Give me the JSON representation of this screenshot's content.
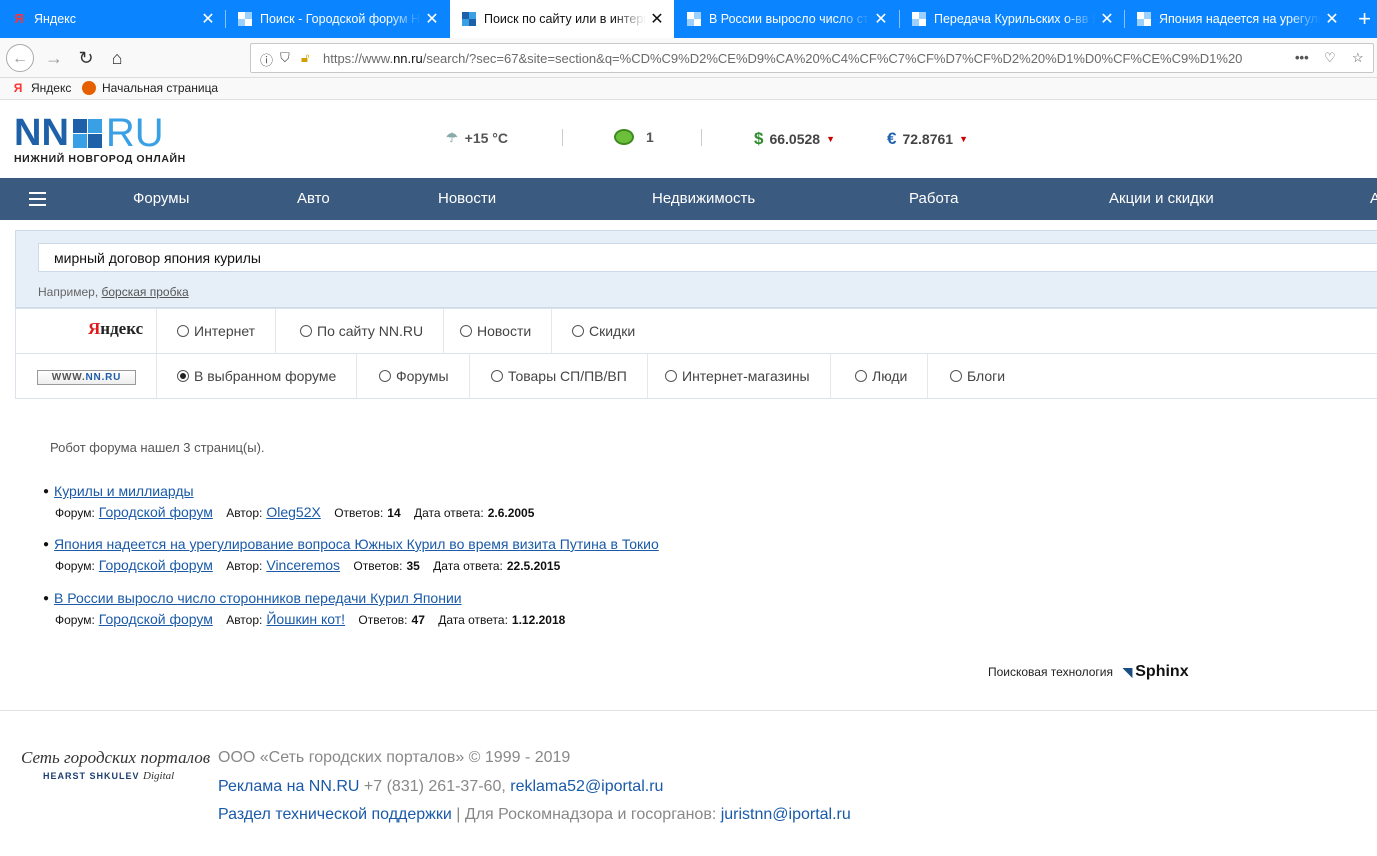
{
  "browser": {
    "tabs": [
      {
        "title": "Яндекс",
        "active": false
      },
      {
        "title": "Поиск - Городской форум Нижнего Новгорода",
        "active": false
      },
      {
        "title": "Поиск по сайту или в интернете",
        "active": true
      },
      {
        "title": "В России выросло число сторонников",
        "active": false
      },
      {
        "title": "Передача Курильских о-вв Японии",
        "active": false
      },
      {
        "title": "Япония надеется на урегулирование",
        "active": false
      }
    ],
    "url_prefix": "https://www.",
    "url_domain": "nn.ru",
    "url_rest": "/search/?sec=67&site=section&q=%CD%C9%D2%CE%D9%CA%20%C4%CF%C7%CF%D7%CF%D2%20%D1%D0%CF%CE%C9%D1%20",
    "bookmarks": [
      "Яндекс",
      "Начальная страница"
    ]
  },
  "header": {
    "logo_left": "NN",
    "logo_right": "RU",
    "tagline": "НИЖНИЙ НОВГОРОД ОНЛАЙН",
    "weather": "+15 °C",
    "traffic": "1",
    "usd_symbol": "$",
    "usd": "66.0528",
    "eur_symbol": "€",
    "eur": "72.8761"
  },
  "nav": [
    "Форумы",
    "Авто",
    "Новости",
    "Недвижимость",
    "Работа",
    "Акции и скидки",
    "А"
  ],
  "search": {
    "query": "мирный договор япония курилы",
    "example_label": "Например,",
    "example_link": "борская пробка",
    "yandex_options": [
      "Интернет",
      "По сайту NN.RU",
      "Новости",
      "Скидки"
    ],
    "site_badge_prefix": "WWW.",
    "site_badge": "NN.RU",
    "site_options": [
      "В выбранном форуме",
      "Форумы",
      "Товары СП/ПВ/ВП",
      "Интернет-магазины",
      "Люди",
      "Блоги"
    ],
    "selected_site_option": 0
  },
  "results": {
    "summary": "Робот форума нашел 3 страниц(ы).",
    "forum_label": "Форум:",
    "author_label": "Автор:",
    "answers_label": "Ответов:",
    "date_label": "Дата ответа:",
    "items": [
      {
        "title": "Курилы и миллиарды",
        "forum": "Городской форум",
        "author": "Oleg52X",
        "answers": "14",
        "date": "2.6.2005"
      },
      {
        "title": "Япония надеется на урегулирование вопроса Южных Курил во время визита Путина в Токио",
        "forum": "Городской форум",
        "author": "Vinceremos",
        "answers": "35",
        "date": "22.5.2015"
      },
      {
        "title": "В России выросло число сторонников передачи Курил Японии",
        "forum": "Городской форум",
        "author": "Йошкин кот!",
        "answers": "47",
        "date": "1.12.2018"
      }
    ],
    "tech_label": "Поисковая технология",
    "tech_name": "Sphinx"
  },
  "footer": {
    "logo_line1": "Сеть городских порталов",
    "logo_line2": "HEARST SHKULEV",
    "logo_line2_suffix": "Digital",
    "copyright": "ООО «Сеть городских порталов» © 1999 - 2019",
    "ads_link": "Реклама на NN.RU",
    "phone": " +7 (831) 261-37-60, ",
    "ads_email": "reklama52@iportal.ru",
    "support_link": "Раздел технической поддержки",
    "rkn_text": " | Для Роскомнадзора и госорганов: ",
    "rkn_email": "juristnn@iportal.ru"
  }
}
